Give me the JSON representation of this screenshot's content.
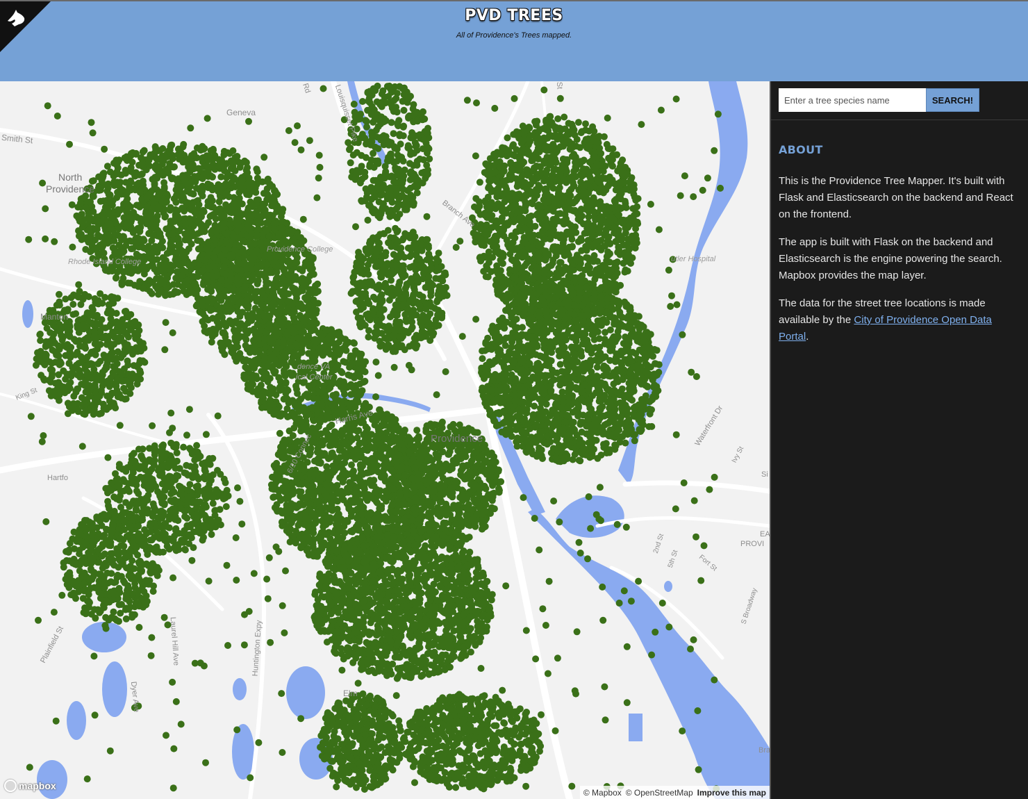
{
  "header": {
    "title": "PVD TREES",
    "subtitle": "All of Providence's Trees mapped.",
    "corner_icon": "github-octocat-icon"
  },
  "search": {
    "placeholder": "Enter a tree species name",
    "button_label": "SEARCH!"
  },
  "about": {
    "heading": "ABOUT",
    "paragraph1": "This is the Providence Tree Mapper. It's built with Flask and Elasticsearch on the backend and React on the frontend.",
    "paragraph2": "The app is built with Flask on the backend and Elasticsearch is the engine powering the search. Mapbox provides the map layer.",
    "paragraph3_before": "The data for the street tree locations is made available by the ",
    "paragraph3_link": "City of Providence Open Data Portal",
    "paragraph3_after": "."
  },
  "map": {
    "labels": {
      "geneva": "Geneva",
      "smith_st": "Smith St",
      "north": "North",
      "providence_town": "Providence",
      "providence_college": "Providence College",
      "rhode_island_college": "Rhode Island College",
      "manton": "Manton",
      "king_st": "King St",
      "hartford": "Hartfo",
      "providence_va": "dence VA",
      "medical_center": "ical Center",
      "harris_ave": "Harris Ave",
      "providence_city": "Providence",
      "connector": "6/10 Connec",
      "louisquisset": "Louisquisset Pike",
      "branch_ave": "Branch Ave",
      "butler": "utler Hospital",
      "waterfront": "Waterfront Dr",
      "ivy_st": "Ivy St",
      "plainfield": "Plainfield St",
      "laurel_hill": "Laurel Hill Ave",
      "huntington": "Huntington Expy",
      "dyer_ave": "Dyer Ave",
      "elm": "Elm",
      "second_st": "2nd St",
      "fifth_st": "5th St",
      "fort_st": "Fort St",
      "s_broadway": "S Broadway",
      "east_prov": "EA",
      "prov_short": "PROVI",
      "rd": "Rd",
      "st": "St",
      "si": "Si",
      "bra": "Bra"
    },
    "colors": {
      "land": "#f2f2f2",
      "water": "#8aaaf0",
      "road": "#ffffff",
      "tree": "#3a7018"
    },
    "logo": "mapbox",
    "attribution": {
      "mapbox": "© Mapbox",
      "osm": "© OpenStreetMap",
      "improve": "Improve this map"
    }
  }
}
